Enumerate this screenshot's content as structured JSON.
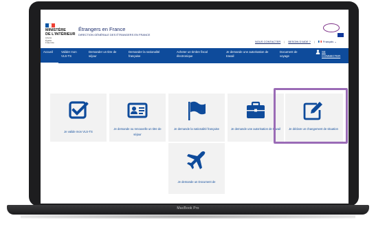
{
  "device_label": "MacBook Pro",
  "header": {
    "ministry": "MINISTÈRE\nDE L'INTÉRIEUR",
    "motto": "Liberté\nÉgalité\nFraternité",
    "site_title": "Étrangers en France",
    "site_subtitle": "DIRECTION GÉNÉRALE DES ÉTRANGERS EN FRANCE",
    "contact_link": "NOUS CONTACTER",
    "help_link": "BESOIN D'AIDE ?",
    "language": "Français"
  },
  "nav": {
    "items": [
      {
        "label": "Accueil",
        "active": true
      },
      {
        "label": "Valider mon\nVLS-TS",
        "active": false
      },
      {
        "label": "Demander un titre de\nséjour",
        "active": false
      },
      {
        "label": "Demander la nationalité\nfrançaise",
        "active": false
      },
      {
        "label": "Acheter un timbre fiscal\nélectronique",
        "active": false
      },
      {
        "label": "Je demande une autorisation de\ntravail",
        "active": false
      },
      {
        "label": "Document de\nvoyage",
        "active": false
      }
    ],
    "login": "SE\nCONNECTER"
  },
  "tiles": [
    {
      "label": "Je valide mon VLS-TS",
      "icon": "checkbox-icon"
    },
    {
      "label": "Je demande ou renouvelle un titre de séjour",
      "icon": "id-card-icon"
    },
    {
      "label": "Je demande la nationalité française",
      "icon": "flag-icon"
    },
    {
      "label": "Je demande une autorisation de travail",
      "icon": "briefcase-icon"
    },
    {
      "label": "Je déclare un changement de situation",
      "icon": "edit-icon"
    },
    {
      "label": "Je demande un Document de",
      "icon": "airplane-icon"
    }
  ],
  "colors": {
    "primary": "#0e4b9b",
    "tile_bg": "#f2f2f2",
    "highlight": "#9a6bb6"
  }
}
